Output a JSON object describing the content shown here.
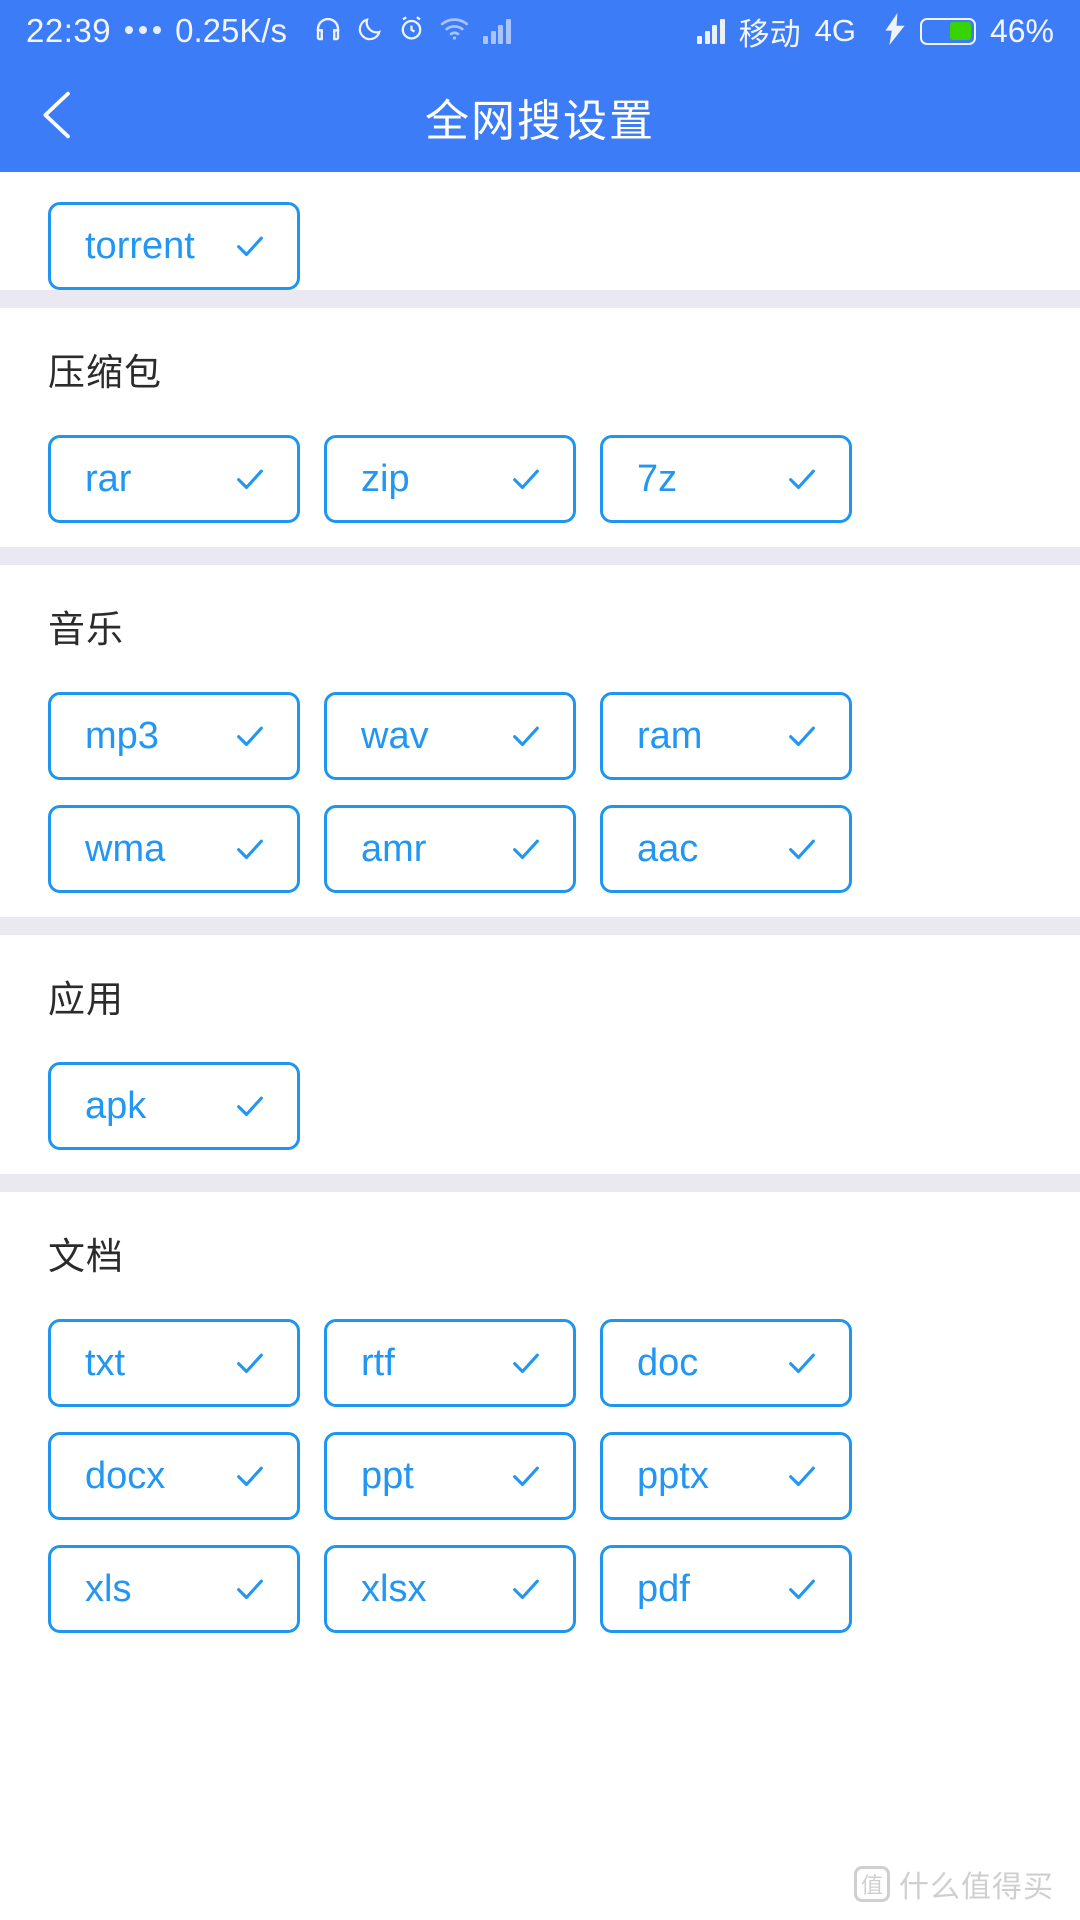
{
  "status_bar": {
    "time": "22:39",
    "net_speed": "0.25K/s",
    "carrier": "移动",
    "network_type": "4G",
    "battery_percent": "46%",
    "battery_level": 46,
    "charging": true,
    "icons": [
      "headphone-icon",
      "moon-icon",
      "alarm-icon",
      "wifi-icon",
      "signal-icon",
      "signal-icon"
    ],
    "background_color": "#3d7cf7"
  },
  "app_bar": {
    "title": "全网搜设置",
    "back_label": "back-arrow",
    "background_color": "#3d7cf7"
  },
  "theme": {
    "accent": "#2196f3",
    "chip_border": "#1e96f0",
    "divider": "#eae9f2",
    "header_blue": "#3d7cf7"
  },
  "partial_top_section": {
    "chips": [
      {
        "label": "torrent",
        "checked": true
      }
    ]
  },
  "sections": [
    {
      "title": "压缩包",
      "chips": [
        {
          "label": "rar",
          "checked": true
        },
        {
          "label": "zip",
          "checked": true
        },
        {
          "label": "7z",
          "checked": true
        }
      ]
    },
    {
      "title": "音乐",
      "chips": [
        {
          "label": "mp3",
          "checked": true
        },
        {
          "label": "wav",
          "checked": true
        },
        {
          "label": "ram",
          "checked": true
        },
        {
          "label": "wma",
          "checked": true
        },
        {
          "label": "amr",
          "checked": true
        },
        {
          "label": "aac",
          "checked": true
        }
      ]
    },
    {
      "title": "应用",
      "chips": [
        {
          "label": "apk",
          "checked": true
        }
      ]
    },
    {
      "title": "文档",
      "chips": [
        {
          "label": "txt",
          "checked": true
        },
        {
          "label": "rtf",
          "checked": true
        },
        {
          "label": "doc",
          "checked": true
        },
        {
          "label": "docx",
          "checked": true
        },
        {
          "label": "ppt",
          "checked": true
        },
        {
          "label": "pptx",
          "checked": true
        },
        {
          "label": "xls",
          "checked": true
        },
        {
          "label": "xlsx",
          "checked": true
        },
        {
          "label": "pdf",
          "checked": true
        }
      ]
    }
  ],
  "watermark": {
    "badge": "值",
    "text": "什么值得买"
  }
}
